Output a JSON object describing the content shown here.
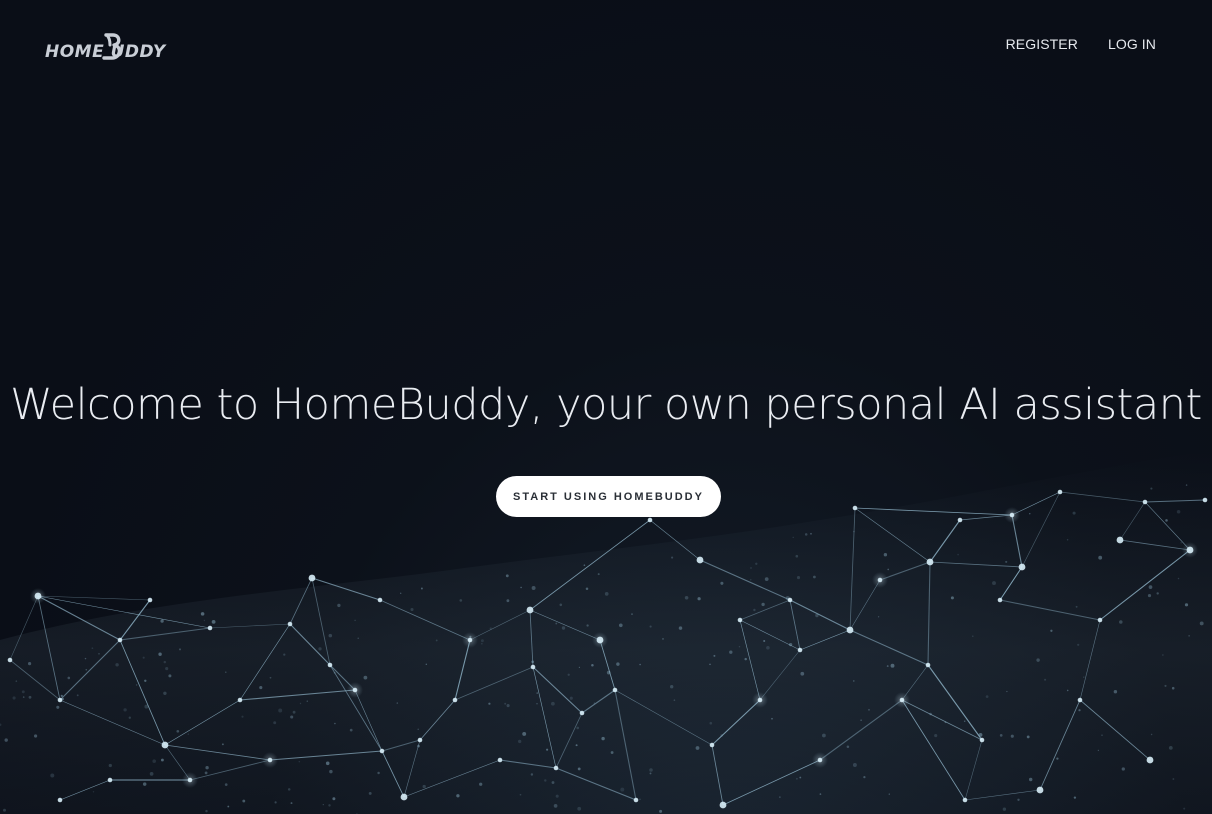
{
  "brand": {
    "name": "HOMEBUDDY",
    "logo_wordmark": "HOME UDDY"
  },
  "nav": {
    "register_label": "REGISTER",
    "login_label": "LOG IN"
  },
  "hero": {
    "title": "Welcome to HomeBuddy, your own personal AI assistant",
    "cta_label": "START USING HOMEBUDDY"
  },
  "colors": {
    "background": "#0a0e17",
    "text": "#e9ecf1",
    "mesh_line": "#8fb4c8",
    "mesh_node": "#d8eef8",
    "button_bg": "#ffffff",
    "button_text": "#2a2f36"
  },
  "background_graphic": "network-mesh"
}
